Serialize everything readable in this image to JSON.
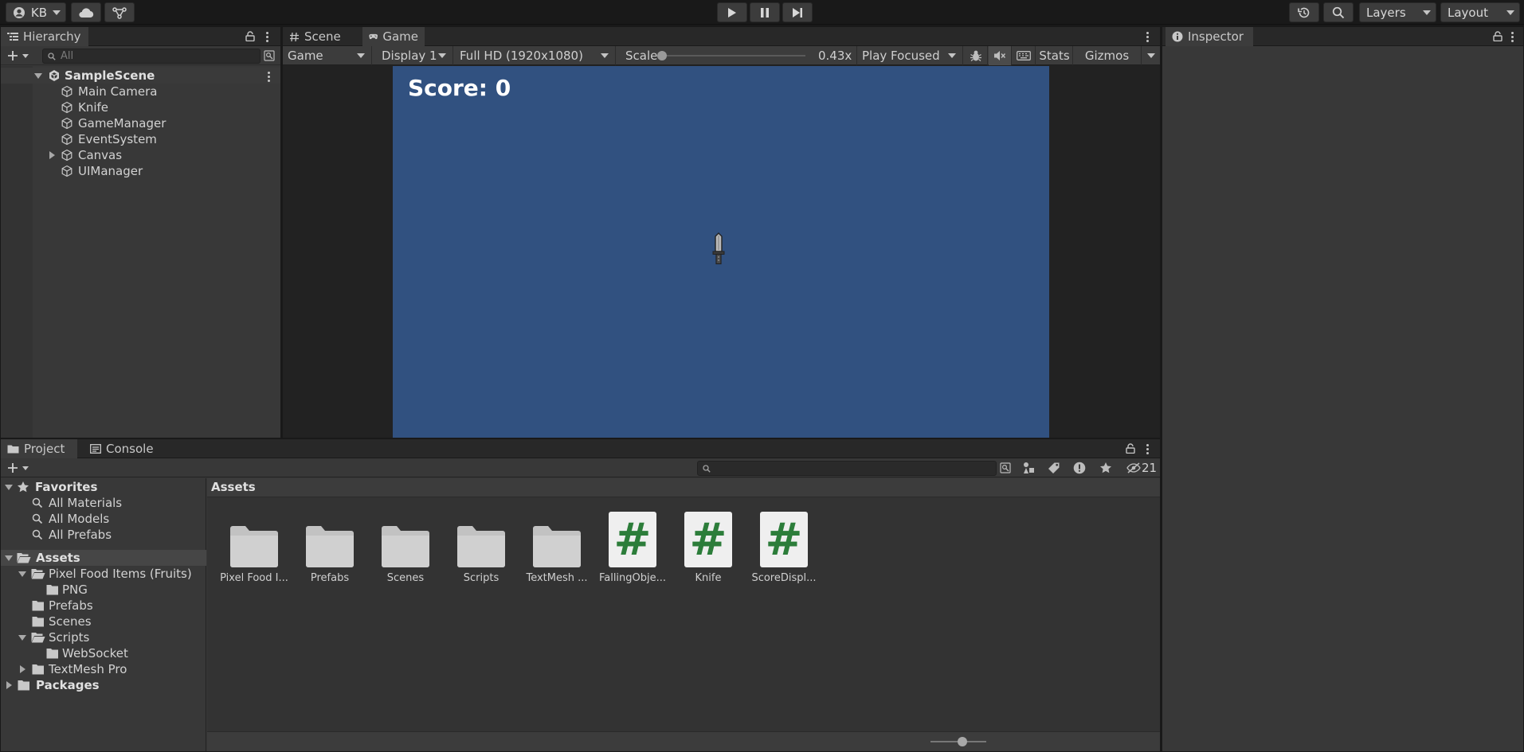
{
  "toolbar": {
    "account": "KB",
    "layers": "Layers",
    "layout": "Layout"
  },
  "hierarchy": {
    "tab": "Hierarchy",
    "search_placeholder": "All",
    "scene": "SampleScene",
    "items": [
      "Main Camera",
      "Knife",
      "GameManager",
      "EventSystem",
      "Canvas",
      "UIManager"
    ]
  },
  "game_view": {
    "tabs": [
      "Scene",
      "Game"
    ],
    "toolbar": {
      "mode": "Game",
      "display": "Display 1",
      "resolution": "Full HD (1920x1080)",
      "scale_label": "Scale",
      "scale_value": "0.43x",
      "scale_level": 0,
      "play_mode": "Play Focused",
      "stats": "Stats",
      "gizmos": "Gizmos"
    },
    "score_text": "Score: 0",
    "background_color": "#315180"
  },
  "inspector": {
    "tab": "Inspector"
  },
  "project": {
    "tabs": [
      "Project",
      "Console"
    ],
    "hidden_count": "21",
    "favorites": {
      "label": "Favorites",
      "items": [
        "All Materials",
        "All Models",
        "All Prefabs"
      ]
    },
    "tree": {
      "assets": "Assets",
      "pixel_food": "Pixel Food Items (Fruits)",
      "png": "PNG",
      "prefabs": "Prefabs",
      "scenes": "Scenes",
      "scripts": "Scripts",
      "websocket": "WebSocket",
      "textmesh": "TextMesh Pro",
      "packages": "Packages"
    },
    "breadcrumb": "Assets",
    "assets": [
      {
        "name": "Pixel Food I...",
        "type": "folder"
      },
      {
        "name": "Prefabs",
        "type": "folder"
      },
      {
        "name": "Scenes",
        "type": "folder"
      },
      {
        "name": "Scripts",
        "type": "folder"
      },
      {
        "name": "TextMesh ...",
        "type": "folder"
      },
      {
        "name": "FallingObje...",
        "type": "script"
      },
      {
        "name": "Knife",
        "type": "script"
      },
      {
        "name": "ScoreDispl...",
        "type": "script"
      }
    ]
  }
}
